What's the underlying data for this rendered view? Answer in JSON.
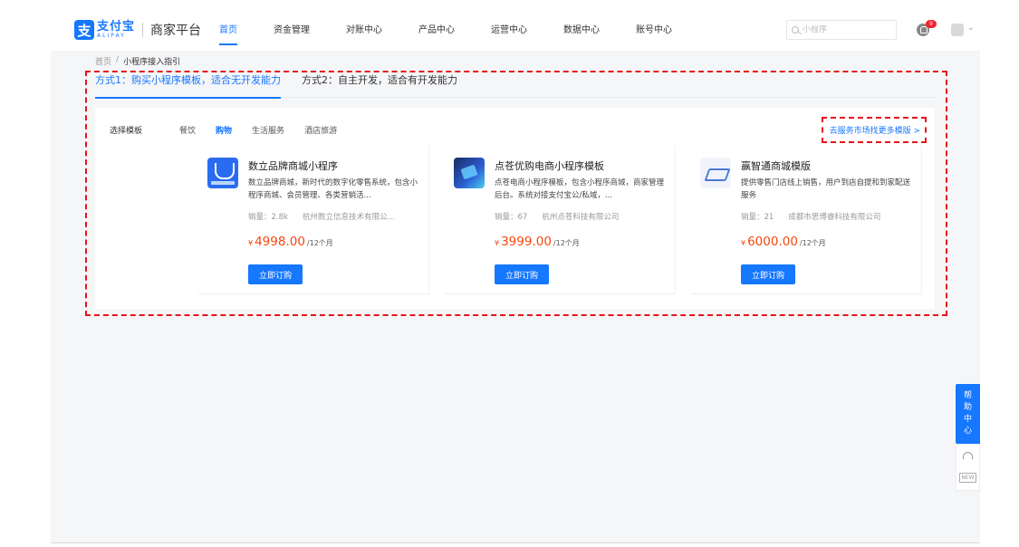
{
  "header": {
    "logo_cn": "支付宝",
    "logo_en": "ALIPAY",
    "platform": "商家平台",
    "nav": [
      "首页",
      "资金管理",
      "对账中心",
      "产品中心",
      "运营中心",
      "数据中心",
      "账号中心"
    ],
    "active_nav": 0,
    "search_placeholder": "小程序",
    "notification_count": "9"
  },
  "breadcrumb": {
    "home": "首页",
    "separator": "/",
    "current": "小程序接入指引"
  },
  "tabs": [
    {
      "label": "方式1：购买小程序模板，适合无开发能力",
      "active": true
    },
    {
      "label": "方式2：自主开发，适合有开发能力",
      "active": false
    }
  ],
  "categories": {
    "label": "选择模板",
    "items": [
      "餐饮",
      "购物",
      "生活服务",
      "酒店旅游"
    ],
    "active": 1,
    "more_link": "去服务市场找更多模版 >"
  },
  "products": [
    {
      "title": "数立品牌商城小程序",
      "desc": "数立品牌商城，新时代的数字化零售系统，包含小程序商城、会员管理、各类营销活...",
      "sales": "销量：2.8k",
      "vendor": "杭州数立信息技术有限公...",
      "currency": "¥",
      "price": "4998.00",
      "period": "/12个月",
      "buy": "立即订购",
      "icon": "shopping-bag-icon"
    },
    {
      "title": "点苍优购电商小程序模板",
      "desc": "点苍电商小程序模板，包含小程序商城，商家管理后台。系统对接支付宝公/私域，...",
      "sales": "销量：67",
      "vendor": "杭州点苍科技有限公司",
      "currency": "¥",
      "price": "3999.00",
      "period": "/12个月",
      "buy": "立即订购",
      "icon": "isometric-platform-icon"
    },
    {
      "title": "赢智通商城模版",
      "desc": "提供零售门店线上销售，用户到店自提和到家配送服务",
      "sales": "销量：21",
      "vendor": "成都市思博睿科技有限公司",
      "currency": "¥",
      "price": "6000.00",
      "period": "/12个月",
      "buy": "立即订购",
      "icon": "laptop-illustration-icon"
    }
  ],
  "help": {
    "chars": [
      "帮",
      "助",
      "中",
      "心"
    ],
    "new_label": "NEW"
  },
  "colors": {
    "primary": "#1677ff",
    "price": "#f5460d",
    "highlight_dash": "#e5141a"
  }
}
